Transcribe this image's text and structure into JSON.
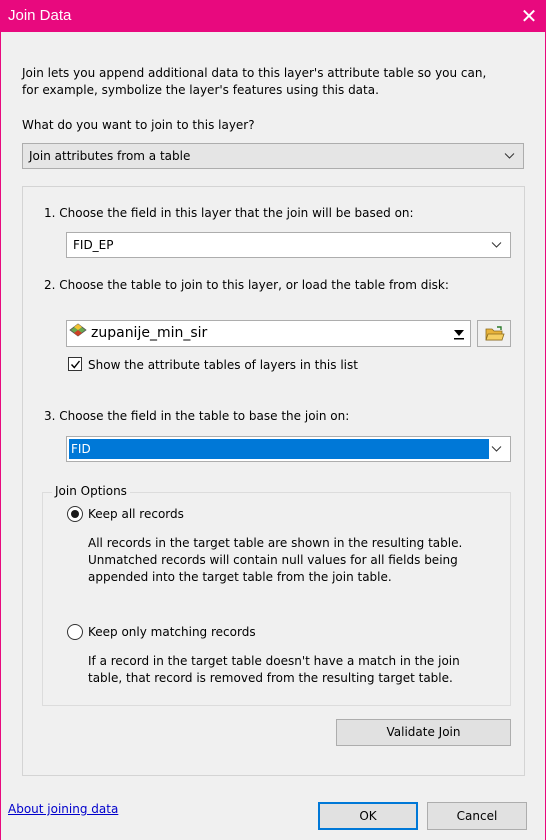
{
  "window": {
    "title": "Join Data",
    "close_glyph": "✕",
    "title_bar_color": "#e8097e"
  },
  "intro": {
    "line1": "Join lets you append additional data to this layer's attribute table so you can,",
    "line2": "for example, symbolize the layer's features using this data."
  },
  "join_type": {
    "question": "What do you want to join to this layer?",
    "selected": "Join attributes from a table"
  },
  "step1": {
    "label": "1.  Choose the field in this layer that the join will be based on:",
    "selected": "FID_EP"
  },
  "step2": {
    "label": "2.  Choose the table to join to this layer, or load the table from disk:",
    "selected": "zupanije_min_sir",
    "layer_icon": "layer-diamond-icon",
    "browse_icon": "open-folder-icon",
    "checkbox_label": "Show the attribute tables of layers in this list",
    "checkbox_checked": true
  },
  "step3": {
    "label": "3.  Choose the field in the table to base the join on:",
    "selected": "FID",
    "highlight_color": "#0078d7"
  },
  "join_options": {
    "title": "Join Options",
    "keep_all": {
      "label": "Keep all records",
      "selected": true,
      "desc1": "All records in the target table are shown in the resulting table.",
      "desc2": "Unmatched records will contain null values for all fields being",
      "desc3": "appended into the target table from the join table."
    },
    "keep_matching": {
      "label": "Keep only matching records",
      "selected": false,
      "desc1": "If a record in the target table doesn't have a match in the join",
      "desc2": "table, that record is removed from the resulting target table."
    }
  },
  "buttons": {
    "validate": "Validate Join",
    "ok": "OK",
    "cancel": "Cancel"
  },
  "footer": {
    "help_link": "About joining data"
  }
}
